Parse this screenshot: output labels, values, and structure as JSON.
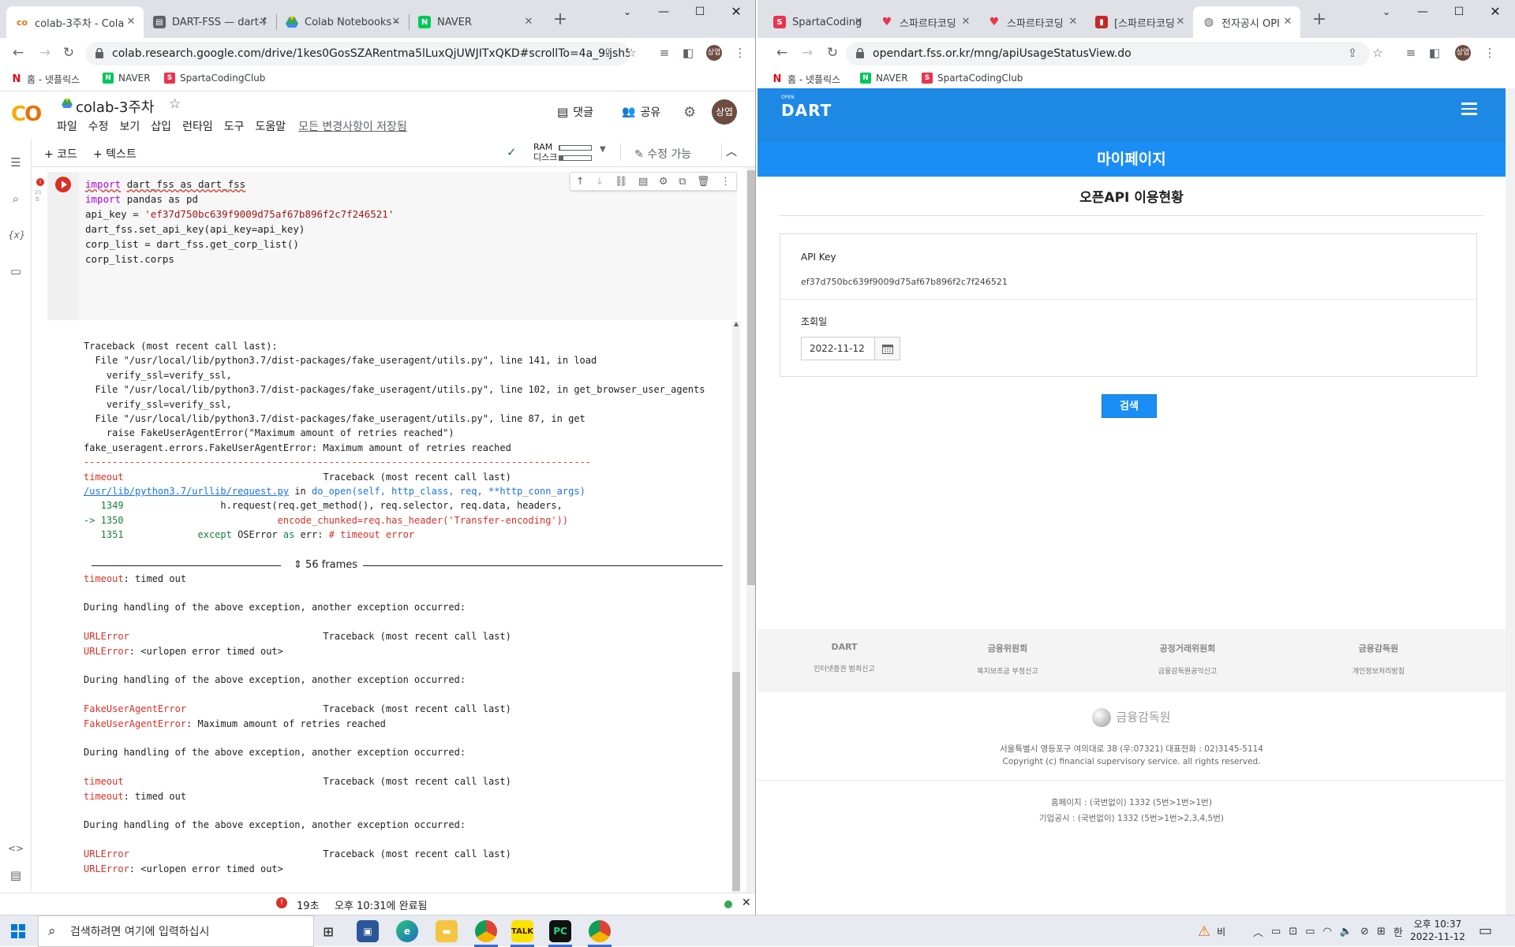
{
  "left_window": {
    "tabs": [
      {
        "label": "colab-3주차 - Cola",
        "favicon": "colab",
        "active": true
      },
      {
        "label": "DART-FSS — dart-f",
        "favicon": "doc"
      },
      {
        "label": "Colab Notebooks -",
        "favicon": "drive"
      },
      {
        "label": "NAVER",
        "favicon": "naver"
      }
    ],
    "url": "colab.research.google.com/drive/1kes0GosSZARentma5lLuxQjUWJITxQKD#scrollTo=4a_9-jsh5rEI",
    "profile": "상엽",
    "bookmarks": [
      {
        "label": "홈 - 넷플릭스",
        "icon": "netflix-icon"
      },
      {
        "label": "NAVER",
        "icon": "naver-icon"
      },
      {
        "label": "SpartaCodingClub",
        "icon": "sparta-icon"
      }
    ]
  },
  "colab": {
    "title": "colab-3주차",
    "menu": [
      "파일",
      "수정",
      "보기",
      "삽입",
      "런타임",
      "도구",
      "도움말"
    ],
    "saved_status": "모든 변경사항이 저장됨",
    "comment_label": "댓글",
    "share_label": "공유",
    "avatar": "상엽",
    "add_code": "+ 코드",
    "add_text": "+ 텍스트",
    "ram_label": "RAM",
    "disk_label": "디스크",
    "ram_fill": 0.02,
    "disk_fill": 0.12,
    "edit_mode": "수정 가능",
    "cell_meta": [
      "21",
      "초"
    ],
    "code_lines": [
      "import dart_fss as dart_fss",
      "import pandas as pd",
      "",
      "api_key = 'ef37d750bc639f9009d75af67b896f2c7f246521'",
      "dart_fss.set_api_key(api_key=api_key)",
      "",
      "corp_list = dart_fss.get_corp_list()",
      "",
      "corp_list.corps"
    ],
    "frames_label": "56 frames",
    "status_time": "19초",
    "status_done": "오후 10:31에 완료됨"
  },
  "right_window": {
    "tabs": [
      {
        "label": "SpartaCoding",
        "favicon": "sparta"
      },
      {
        "label": "스파르타코딩",
        "favicon": "heart"
      },
      {
        "label": "스파르타코딩",
        "favicon": "heart"
      },
      {
        "label": "[스파르타코딩",
        "favicon": "book"
      },
      {
        "label": "전자공시 OPI",
        "favicon": "globe",
        "active": true
      }
    ],
    "url": "opendart.fss.or.kr/mng/apiUsageStatusView.do",
    "profile": "상엽",
    "bookmarks": [
      {
        "label": "홈 - 넷플릭스",
        "icon": "netflix-icon"
      },
      {
        "label": "NAVER",
        "icon": "naver-icon"
      },
      {
        "label": "SpartaCodingClub",
        "icon": "sparta-icon"
      }
    ]
  },
  "dart": {
    "logo_small": "OPEN",
    "logo": "DART",
    "mypage": "마이페이지",
    "heading": "오픈API 이용현황",
    "api_key_label": "API Key",
    "api_key": "ef37d750bc639f9009d75af67b896f2c7f246521",
    "date_label": "조회일",
    "date": "2022-11-12",
    "search": "검색",
    "footer_links": [
      {
        "org": "DART",
        "link": "인터넷증권 범죄신고"
      },
      {
        "org": "금융위원회",
        "link": "복지보조금 부정신고"
      },
      {
        "org": "공정거래위원회",
        "link": "금융감독원공익신고"
      },
      {
        "org": "금융감독원",
        "link": "개인정보처리방침"
      }
    ],
    "fss": "금융감독원",
    "address": "서울특별시 영등포구 여의대로 38 (우:07321) 대표전화 : 02)3145-5114",
    "copyright": "Copyright (c) financial supervisory service. all rights reserved.",
    "homepage_tel": "홈페이지 : (국번없이) 1332 (5번>1번>1번)",
    "corp_tel": "기업공시 : (국번없이) 1332 (5번>1번>2,3,4,5번)"
  },
  "taskbar": {
    "search_placeholder": "검색하려면 여기에 입력하십시",
    "weather": "비",
    "ime": "한",
    "time": "오후 10:37",
    "date": "2022-11-12"
  }
}
